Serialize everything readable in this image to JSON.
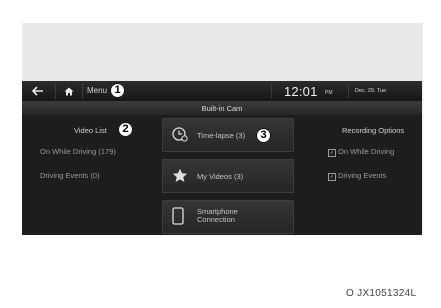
{
  "topbar": {
    "menu_label": "Menu",
    "time": "12:01",
    "ampm": "PM",
    "date": "Dec. 29. Tue"
  },
  "screen_title": "Built-in Cam",
  "video_list": {
    "header": "Video List",
    "items": [
      {
        "label": "On While Driving (179)"
      },
      {
        "label": "Driving Events (0)"
      }
    ]
  },
  "center_tiles": [
    {
      "label": "Time-lapse (3)",
      "icon": "timelapse-clock-icon"
    },
    {
      "label": "My Videos (3)",
      "icon": "star-icon"
    },
    {
      "label_line1": "Smartphone",
      "label_line2": "Connection",
      "icon": "smartphone-icon"
    }
  ],
  "recording_options": {
    "header": "Recording Options",
    "items": [
      {
        "label": "On While Driving",
        "checked": true
      },
      {
        "label": "Driving Events",
        "checked": true
      }
    ]
  },
  "callouts": [
    "1",
    "2",
    "3"
  ],
  "figure_code": "O JX1051324L",
  "colors": {
    "screen_bg": "#1d1d1d",
    "panel_bg": "#e9e9e9",
    "text_primary": "#dedede",
    "text_secondary": "#9a9a9a"
  }
}
